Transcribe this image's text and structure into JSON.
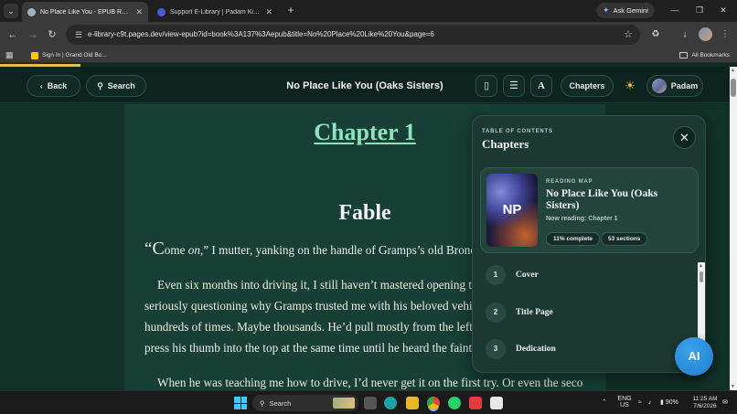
{
  "browser": {
    "tabs": [
      {
        "title": "No Place Like You - EPUB Reader",
        "active": true,
        "favicon_color": "#9bb0c8"
      },
      {
        "title": "Support E-Library | Padam Kishore",
        "active": false,
        "favicon_color": "#4a5bd8"
      }
    ],
    "gemini_label": "Ask Gemini",
    "url": "e-library-c9t.pages.dev/view-epub?id=book%3A137%3Aepub&title=No%20Place%20Like%20You&page=6",
    "bookmarks": [
      {
        "label": "Sign In | Grand Old Bo..."
      }
    ],
    "all_bookmarks_label": "All Bookmarks"
  },
  "reader": {
    "progress_fraction": 0.11,
    "back_label": "Back",
    "search_label": "Search",
    "book_title": "No Place Like You (Oaks Sisters)",
    "font_button_label": "A",
    "chapters_label": "Chapters",
    "user_name": "Padam",
    "accent_color": "#8fe1bf"
  },
  "content": {
    "chapter_heading": "Chapter 1",
    "section_heading": "Fable",
    "paragraphs": [
      {
        "quote_open": "“",
        "drop_cap": "C",
        "lines": [
          [
            "ome ",
            "on",
            ",” I mutter, yanking on the handle of Gramps’s old Bronco’s door."
          ]
        ]
      },
      {
        "lines": [
          "Even six months into driving it, I still haven’t mastered opening the door. I’m",
          "seriously questioning why Gramps trusted me with his beloved vehicle. I watched him do it",
          "hundreds of times. Maybe thousands. He’d pull mostly from the left edge of the door and",
          "press his thumb into the top at the same time until he heard the faint pop of the latch."
        ]
      },
      {
        "lines": [
          "When he was teaching me how to drive, I’d never get it on the first try. Or even the second."
        ]
      }
    ]
  },
  "toc": {
    "kicker": "TABLE OF CONTENTS",
    "title": "Chapters",
    "reading_map": {
      "kicker": "READING MAP",
      "cover_initials": "NP",
      "book_title": "No Place Like You (Oaks Sisters)",
      "now_reading": "Now reading: Chapter 1",
      "complete_badge": "11% complete",
      "sections_badge": "53 sections"
    },
    "items": [
      {
        "num": "1",
        "label": "Cover"
      },
      {
        "num": "2",
        "label": "Title Page"
      },
      {
        "num": "3",
        "label": "Dedication"
      }
    ]
  },
  "ai_button_label": "AI",
  "taskbar": {
    "search_label": "Search",
    "lang_top": "ENG",
    "lang_bottom": "US",
    "battery": "90%",
    "time": "11:25 AM",
    "date": "7/6/2026"
  }
}
